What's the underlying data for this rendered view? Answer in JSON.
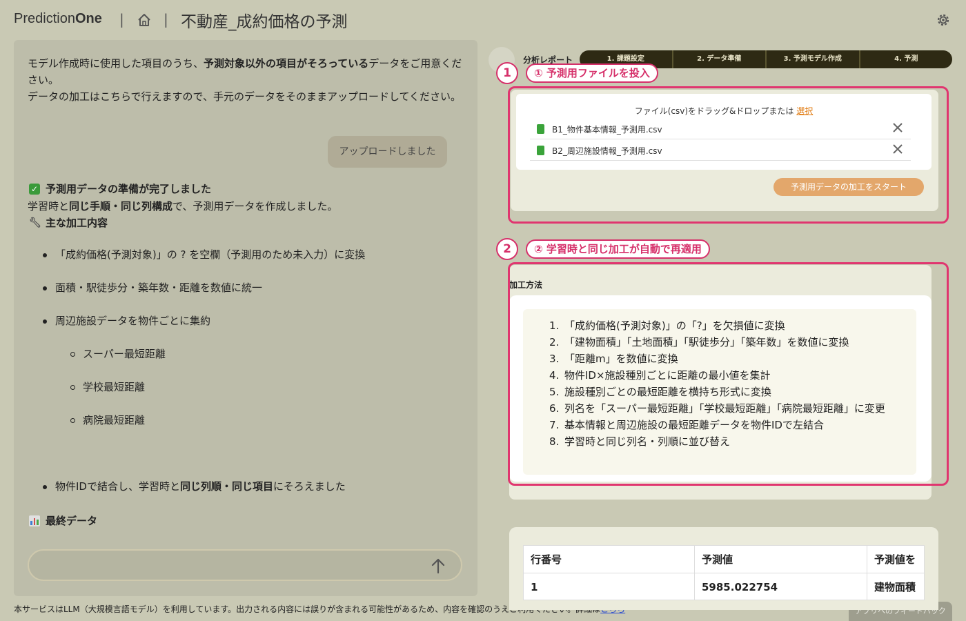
{
  "header": {
    "brand_light": "Prediction",
    "brand_bold": "One",
    "sep": "|",
    "title": "不動産_成約価格の予測"
  },
  "chat": {
    "intro_pre": "モデル作成時に使用した項目のうち、",
    "intro_bold": "予測対象以外の項目がそろっている",
    "intro_post": "データをご用意ください。",
    "intro2": "データの加工はこちらで行えますので、手元のデータをそのままアップロードしてください。",
    "user_message": "アップロードしました",
    "done_title": "予測用データの準備が完了しました",
    "made_pre": "学習時と",
    "made_bold": "同じ手順・同じ列構成",
    "made_post": "で、予測用データを作成しました。",
    "main_proc": "主な加工内容",
    "bullet1": "「成約価格(予測対象)」の ? を空欄（予測用のため未入力）に変換",
    "bullet2": "面積・駅徒歩分・築年数・距離を数値に統一",
    "bullet3": "周辺施設データを物件ごとに集約",
    "sub1": "スーパー最短距離",
    "sub2": "学校最短距離",
    "sub3": "病院最短距離",
    "bullet4_pre": "物件IDで結合し、学習時と",
    "bullet4_bold": "同じ列順・同じ項目",
    "bullet4_post": "にそろえました",
    "final_title": "最終データ",
    "input_placeholder": ""
  },
  "footer": {
    "note": "本サービスはLLM（大規模言語モデル）を利用しています。出力される内容には誤りが含まれる可能性があるため、内容を確認のうえご利用ください。詳細は",
    "link": "こちら",
    "feedback": "アプリへのフィードバック"
  },
  "report": {
    "label": "分析レポート",
    "steps": [
      "1. 課題設定",
      "2. データ準備",
      "3. 予測モデル作成",
      "4. 予測"
    ]
  },
  "callouts": {
    "c1_num": "1",
    "c1_label": "① 予測用ファイルを投入",
    "c2_num": "2",
    "c2_label": "② 学習時と同じ加工が自動で再適用"
  },
  "upload": {
    "drop_text": "ファイル(csv)をドラッグ&ドロップまたは",
    "select_link": "選択",
    "files": [
      "B1_物件基本情報_予測用.csv",
      "B2_周辺施設情報_予測用.csv"
    ],
    "start_button": "予測用データの加工をスタート"
  },
  "method": {
    "label": "加工方法",
    "steps": [
      "「成約価格(予測対象)」の「?」を欠損値に変換",
      "「建物面積」「土地面積」「駅徒歩分」「築年数」を数値に変換",
      "「距離m」を数値に変換",
      "物件ID×施設種別ごとに距離の最小値を集計",
      "施設種別ごとの最短距離を横持ち形式に変換",
      "列名を「スーパー最短距離」「学校最短距離」「病院最短距離」に変更",
      "基本情報と周辺施設の最短距離データを物件IDで左結合",
      "学習時と同じ列名・列順に並び替え"
    ],
    "nums": [
      "1.",
      "2.",
      "3.",
      "4.",
      "5.",
      "6.",
      "7.",
      "8."
    ]
  },
  "result_table": {
    "headers": [
      "行番号",
      "予測値",
      "予測値を"
    ],
    "rows": [
      [
        "1",
        "5985.022754",
        "建物面積"
      ]
    ]
  },
  "colors": {
    "background": "#c9c9b4",
    "accent_pink": "#e0356f",
    "button_orange": "#e3a76b",
    "steps_dark": "#2e2a14"
  },
  "icons": {
    "home": "home-icon",
    "settings": "gear-icon",
    "send": "arrow-up-icon",
    "check": "check-icon",
    "wrench": "wrench-icon",
    "chart": "bar-chart-icon",
    "csv": "csv-file-icon",
    "remove": "close-icon"
  }
}
